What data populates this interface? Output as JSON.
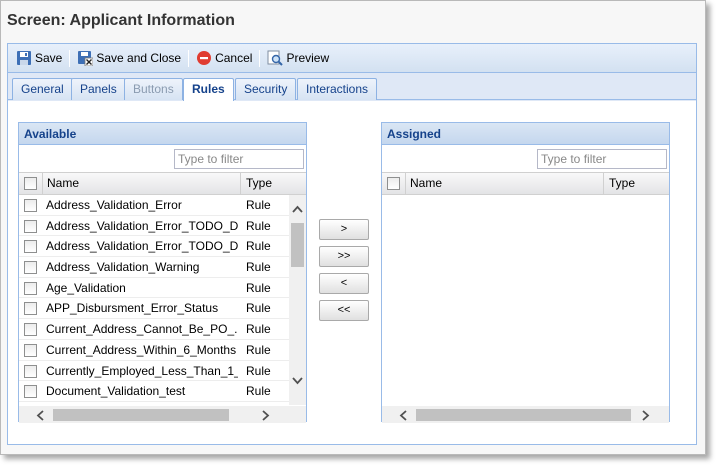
{
  "screen": {
    "title": "Screen: Applicant Information"
  },
  "toolbar": {
    "save_label": "Save",
    "save_close_label": "Save and Close",
    "cancel_label": "Cancel",
    "preview_label": "Preview"
  },
  "tabs": [
    {
      "label": "General",
      "state": "normal"
    },
    {
      "label": "Panels",
      "state": "normal"
    },
    {
      "label": "Buttons",
      "state": "disabled"
    },
    {
      "label": "Rules",
      "state": "active"
    },
    {
      "label": "Security",
      "state": "normal"
    },
    {
      "label": "Interactions",
      "state": "normal"
    }
  ],
  "available": {
    "title": "Available",
    "filter_placeholder": "Type to filter",
    "col_name": "Name",
    "col_type": "Type",
    "rows": [
      {
        "name": "Address_Validation_Error",
        "type": "Rule"
      },
      {
        "name": "Address_Validation_Error_TODO_Dec",
        "type": "Rule"
      },
      {
        "name": "Address_Validation_Error_TODO_D...",
        "type": "Rule"
      },
      {
        "name": "Address_Validation_Warning",
        "type": "Rule"
      },
      {
        "name": "Age_Validation",
        "type": "Rule"
      },
      {
        "name": "APP_Disbursment_Error_Status",
        "type": "Rule"
      },
      {
        "name": "Current_Address_Cannot_Be_PO_...",
        "type": "Rule"
      },
      {
        "name": "Current_Address_Within_6_Months",
        "type": "Rule"
      },
      {
        "name": "Currently_Employed_Less_Than_1_...",
        "type": "Rule"
      },
      {
        "name": "Document_Validation_test",
        "type": "Rule"
      }
    ]
  },
  "assigned": {
    "title": "Assigned",
    "filter_placeholder": "Type to filter",
    "col_name": "Name",
    "col_type": "Type",
    "rows": []
  },
  "move_buttons": {
    "add": ">",
    "add_all": ">>",
    "remove": "<",
    "remove_all": "<<"
  },
  "colors": {
    "panel_border": "#99bbe8",
    "header_text": "#15428b",
    "toolbar_bg": "#d3e1f1"
  }
}
